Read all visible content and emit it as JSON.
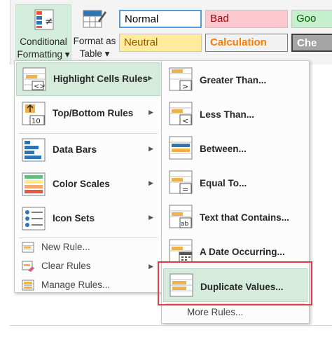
{
  "ribbon": {
    "conditional_formatting": {
      "line1": "Conditional",
      "line2": "Formatting ▾"
    },
    "format_as_table": {
      "line1": "Format as",
      "line2": "Table ▾"
    },
    "styles": [
      {
        "label": "Normal",
        "bg": "#ffffff",
        "fg": "#000000"
      },
      {
        "label": "Bad",
        "bg": "#ffc7ce",
        "fg": "#9c0006"
      },
      {
        "label": "Goo",
        "bg": "#c6efce",
        "fg": "#006100"
      },
      {
        "label": "Neutral",
        "bg": "#ffeb9c",
        "fg": "#9c5700"
      },
      {
        "label": "Calculation",
        "bg": "#f2f2f2",
        "fg": "#fa7d00"
      },
      {
        "label": "Che",
        "bg": "#a5a5a5",
        "fg": "#ffffff"
      }
    ]
  },
  "menu": {
    "items": [
      {
        "label": "Highlight Cells Rules",
        "icon": "highlight-cells-icon",
        "has_submenu": true,
        "active": true
      },
      {
        "label": "Top/Bottom Rules",
        "icon": "top-bottom-icon",
        "has_submenu": true
      },
      {
        "label": "Data Bars",
        "icon": "data-bars-icon",
        "has_submenu": true
      },
      {
        "label": "Color Scales",
        "icon": "color-scales-icon",
        "has_submenu": true
      },
      {
        "label": "Icon Sets",
        "icon": "icon-sets-icon",
        "has_submenu": true
      }
    ],
    "small_items": [
      {
        "label": "New Rule...",
        "icon": "new-rule-icon",
        "has_submenu": false
      },
      {
        "label": "Clear Rules",
        "icon": "clear-rules-icon",
        "has_submenu": true
      },
      {
        "label": "Manage Rules...",
        "icon": "manage-rules-icon",
        "has_submenu": false
      }
    ]
  },
  "submenu": {
    "items": [
      {
        "label": "Greater Than...",
        "icon": "greater-than-icon"
      },
      {
        "label": "Less Than...",
        "icon": "less-than-icon"
      },
      {
        "label": "Between...",
        "icon": "between-icon"
      },
      {
        "label": "Equal To...",
        "icon": "equal-to-icon"
      },
      {
        "label": "Text that Contains...",
        "icon": "text-contains-icon"
      },
      {
        "label": "A Date Occurring...",
        "icon": "date-occurring-icon"
      },
      {
        "label": "Duplicate Values...",
        "icon": "duplicate-values-icon",
        "active": true
      }
    ],
    "more_rules": "More Rules..."
  },
  "colors": {
    "highlight": "#d5ebdc",
    "callout_red": "#e03a4a",
    "accent_orange": "#f0b04a",
    "accent_blue": "#2e75b6"
  }
}
